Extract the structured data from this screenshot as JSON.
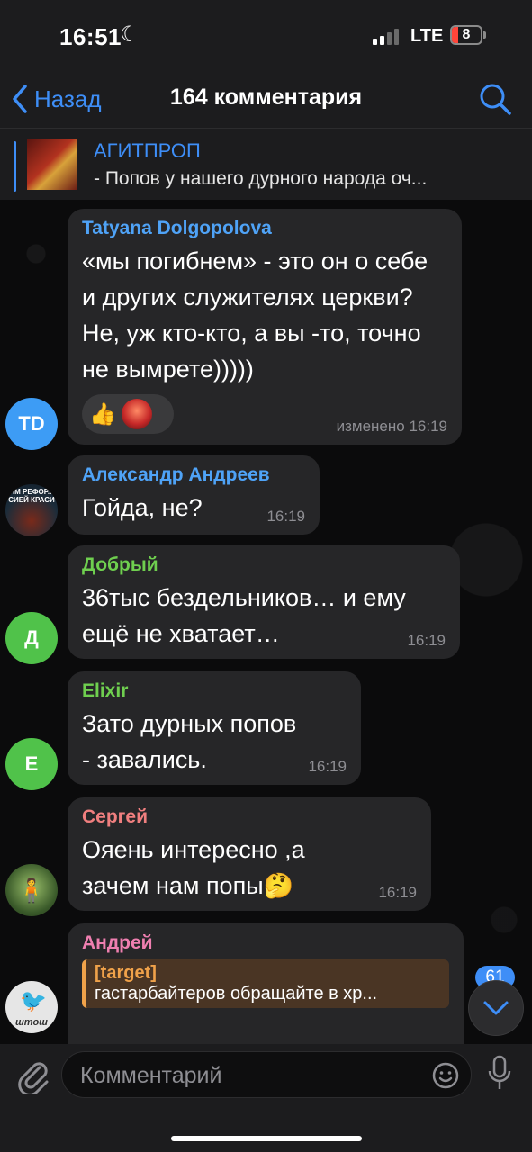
{
  "status": {
    "time": "16:51",
    "network": "LTE",
    "battery": "8"
  },
  "nav": {
    "back_label": "Назад",
    "title": "164 комментария"
  },
  "pinned": {
    "channel": "АГИТПРОП",
    "text": "- Попов у нашего дурного народа оч..."
  },
  "messages": [
    {
      "author": "Tatyana Dolgopolova",
      "author_color": "#4fa3f7",
      "text": "«мы погибнем» - это он о себе и других служителях церкви? Не, уж кто-кто, а вы -то, точно не вымрете)))))",
      "time": "изменено 16:19",
      "avatar": "TD",
      "avatar_color": "#3d9cf5",
      "reactions": [
        "👍",
        "rose"
      ]
    },
    {
      "author": "Александр Андреев",
      "author_color": "#4fa3f7",
      "text": "Гойда, не?",
      "time": "16:19",
      "avatar_caption": "ИМ РЕФОР... СИЕЙ КРАСИ"
    },
    {
      "author": "Добрый",
      "author_color": "#6fcf4f",
      "text": "36тыс бездельников… и ему ещё не хватает…",
      "time": "16:19",
      "avatar": "Д",
      "avatar_color": "#50c24a"
    },
    {
      "author": "Elixir",
      "author_color": "#6fcf4f",
      "text": "Зато дурных попов - завались.",
      "time": "16:19",
      "avatar": "E",
      "avatar_color": "#50c24a"
    },
    {
      "author": "Сергей",
      "author_color": "#f07f7f",
      "text": "Ояень интересно ,а зачем нам попы🤔",
      "time": "16:19"
    },
    {
      "author": "Андрей",
      "author_color": "#ef7fb0",
      "reply_author": "[target]",
      "reply_text": "гастарбайтеров обращайте в хр...",
      "avatar_caption": "штош"
    }
  ],
  "unread_count": "61",
  "input": {
    "placeholder": "Комментарий"
  }
}
